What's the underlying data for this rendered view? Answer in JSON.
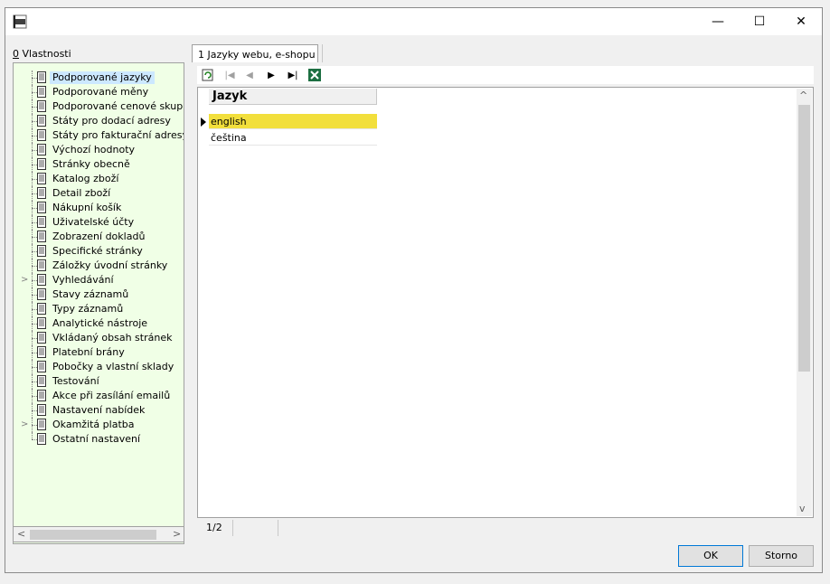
{
  "window": {
    "app_icon": "k2-app-icon",
    "controls": {
      "minimize": "—",
      "maximize": "☐",
      "close": "✕"
    }
  },
  "left_panel": {
    "label_accel": "0",
    "label_rest": " Vlastnosti",
    "tree_items": [
      {
        "label": "Podporované jazyky",
        "selected": true,
        "expandable": false
      },
      {
        "label": "Podporované měny",
        "expandable": false
      },
      {
        "label": "Podporované cenové skupiny",
        "expandable": false
      },
      {
        "label": "Státy pro dodací adresy",
        "expandable": false
      },
      {
        "label": "Státy pro fakturační adresy",
        "expandable": false
      },
      {
        "label": "Výchozí hodnoty",
        "expandable": false
      },
      {
        "label": "Stránky obecně",
        "expandable": false
      },
      {
        "label": "Katalog zboží",
        "expandable": false
      },
      {
        "label": "Detail zboží",
        "expandable": false
      },
      {
        "label": "Nákupní košík",
        "expandable": false
      },
      {
        "label": "Uživatelské účty",
        "expandable": false
      },
      {
        "label": "Zobrazení dokladů",
        "expandable": false
      },
      {
        "label": "Specifické stránky",
        "expandable": false
      },
      {
        "label": "Záložky úvodní stránky",
        "expandable": false
      },
      {
        "label": "Vyhledávání",
        "expandable": true
      },
      {
        "label": "Stavy záznamů",
        "expandable": false
      },
      {
        "label": "Typy záznamů",
        "expandable": false
      },
      {
        "label": "Analytické nástroje",
        "expandable": false
      },
      {
        "label": "Vkládaný obsah stránek",
        "expandable": false
      },
      {
        "label": "Platební brány",
        "expandable": false
      },
      {
        "label": "Pobočky a vlastní sklady",
        "expandable": false
      },
      {
        "label": "Testování",
        "expandable": false
      },
      {
        "label": "Akce při zasílání emailů",
        "expandable": false
      },
      {
        "label": "Nastavení nabídek",
        "expandable": false
      },
      {
        "label": "Okamžitá platba",
        "expandable": true
      },
      {
        "label": "Ostatní nastavení",
        "expandable": false
      }
    ]
  },
  "right_panel": {
    "tab_label": "1 Jazyky webu, e-shopu",
    "toolbar": {
      "refresh": "refresh-icon",
      "first": "|◀",
      "prev": "◀",
      "next": "▶",
      "last": "▶|",
      "excel": "excel-icon"
    },
    "grid": {
      "column_header": "Jazyk",
      "rows": [
        "english",
        "čeština"
      ]
    },
    "status": {
      "position": "1/2"
    }
  },
  "buttons": {
    "ok": "OK",
    "cancel": "Storno"
  },
  "colors": {
    "selected_row": "#f2df3c",
    "tree_bg": "#f0ffe6",
    "tree_selection": "#cce8ff",
    "ok_border": "#0078d7"
  }
}
